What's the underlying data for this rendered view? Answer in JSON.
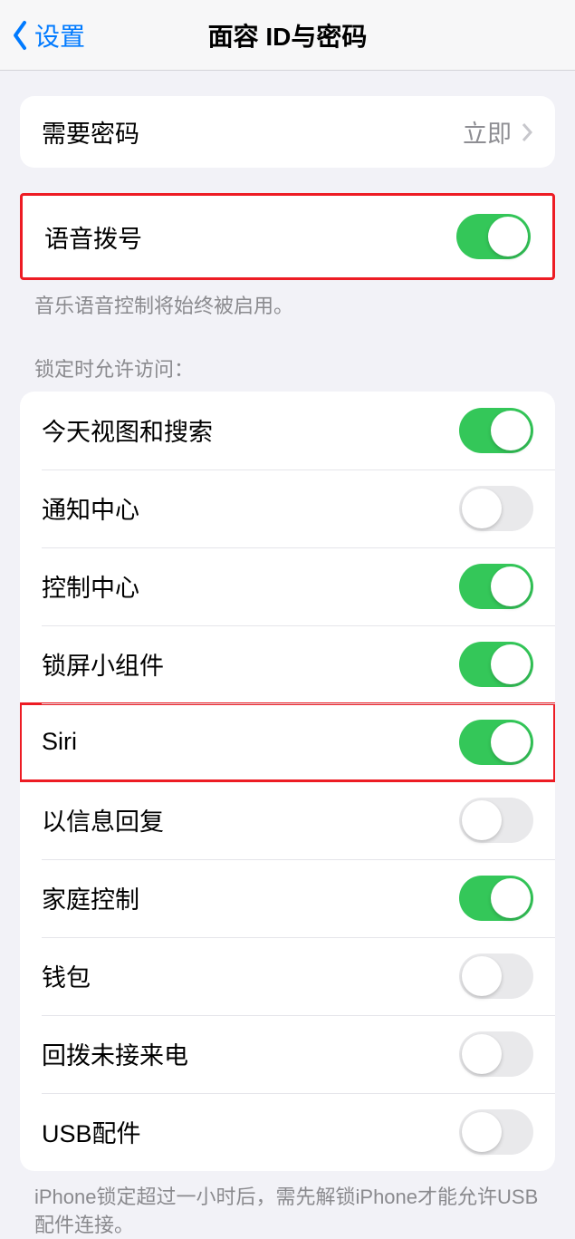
{
  "nav": {
    "back_label": "设置",
    "title": "面容 ID与密码"
  },
  "require_passcode": {
    "label": "需要密码",
    "value": "立即"
  },
  "voice_dial": {
    "label": "语音拨号",
    "enabled": true,
    "footer": "音乐语音控制将始终被启用。"
  },
  "lock_access": {
    "header": "锁定时允许访问：",
    "items": [
      {
        "label": "今天视图和搜索",
        "enabled": true
      },
      {
        "label": "通知中心",
        "enabled": false
      },
      {
        "label": "控制中心",
        "enabled": true
      },
      {
        "label": "锁屏小组件",
        "enabled": true
      },
      {
        "label": "Siri",
        "enabled": true,
        "highlighted": true
      },
      {
        "label": "以信息回复",
        "enabled": false
      },
      {
        "label": "家庭控制",
        "enabled": true
      },
      {
        "label": "钱包",
        "enabled": false
      },
      {
        "label": "回拨未接来电",
        "enabled": false
      },
      {
        "label": "USB配件",
        "enabled": false
      }
    ],
    "footer": "iPhone锁定超过一小时后，需先解锁iPhone才能允许USB 配件连接。"
  }
}
